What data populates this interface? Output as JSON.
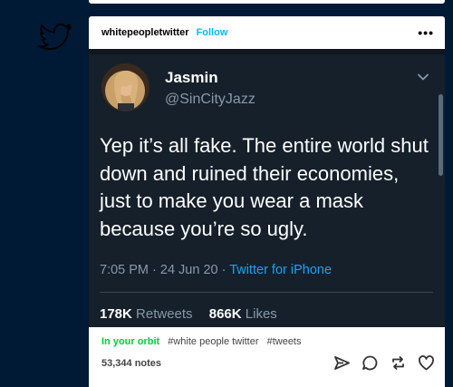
{
  "post": {
    "blog_name": "whitepeopletwitter",
    "follow_label": "Follow",
    "more_label": "•••",
    "tags_label": "In your orbit",
    "tags": [
      "#white people twitter",
      "#tweets"
    ],
    "notes": "53,344 notes"
  },
  "tweet": {
    "display_name": "Jasmin",
    "handle": "@SinCityJazz",
    "text": "Yep it’s all fake. The entire world shut down and ruined their economies, just to make you wear a mask because you’re so ugly.",
    "time": "7:05 PM · 24 Jun 20 · ",
    "source": "Twitter for iPhone",
    "retweets_count": "178K",
    "retweets_label": "Retweets",
    "likes_count": "866K",
    "likes_label": "Likes"
  },
  "colors": {
    "page_bg": "#001935",
    "tweet_bg": "#15202b",
    "link_blue": "#1da1f2",
    "muted": "#8899a6",
    "follow_blue": "#00b8ff",
    "orbit_green": "#00cf35"
  },
  "icons": [
    "twitter-bird-icon",
    "chevron-down-icon",
    "share-icon",
    "reply-icon",
    "reblog-icon",
    "like-icon"
  ]
}
